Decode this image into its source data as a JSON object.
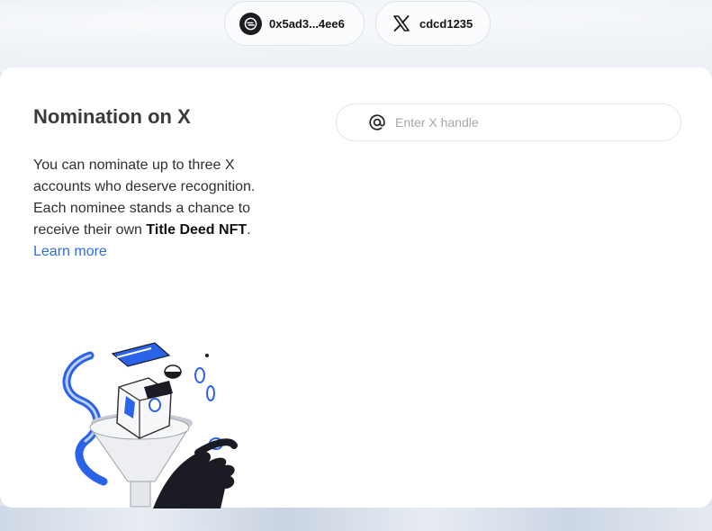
{
  "header": {
    "wallet": {
      "address": "0x5ad3...4ee6",
      "icon": "wallet-icon"
    },
    "x_account": {
      "handle": "cdcd1235",
      "icon": "x-logo-icon"
    }
  },
  "nomination": {
    "title": "Nomination on X",
    "line1": "You can nominate up to three X accounts who deserve recognition.",
    "line2_prefix": "Each nominee stands a chance to receive their own ",
    "line2_bold": "Title Deed NFT",
    "line2_suffix": ".",
    "learn_more": "Learn more",
    "illustration_icon": "box-funnel-illustration"
  },
  "handle_input": {
    "placeholder": "Enter X handle",
    "value": "",
    "icon": "at-icon"
  },
  "colors": {
    "link": "#2d6fe0",
    "accent_blue": "#2a63e8",
    "dark": "#1b1b24"
  }
}
